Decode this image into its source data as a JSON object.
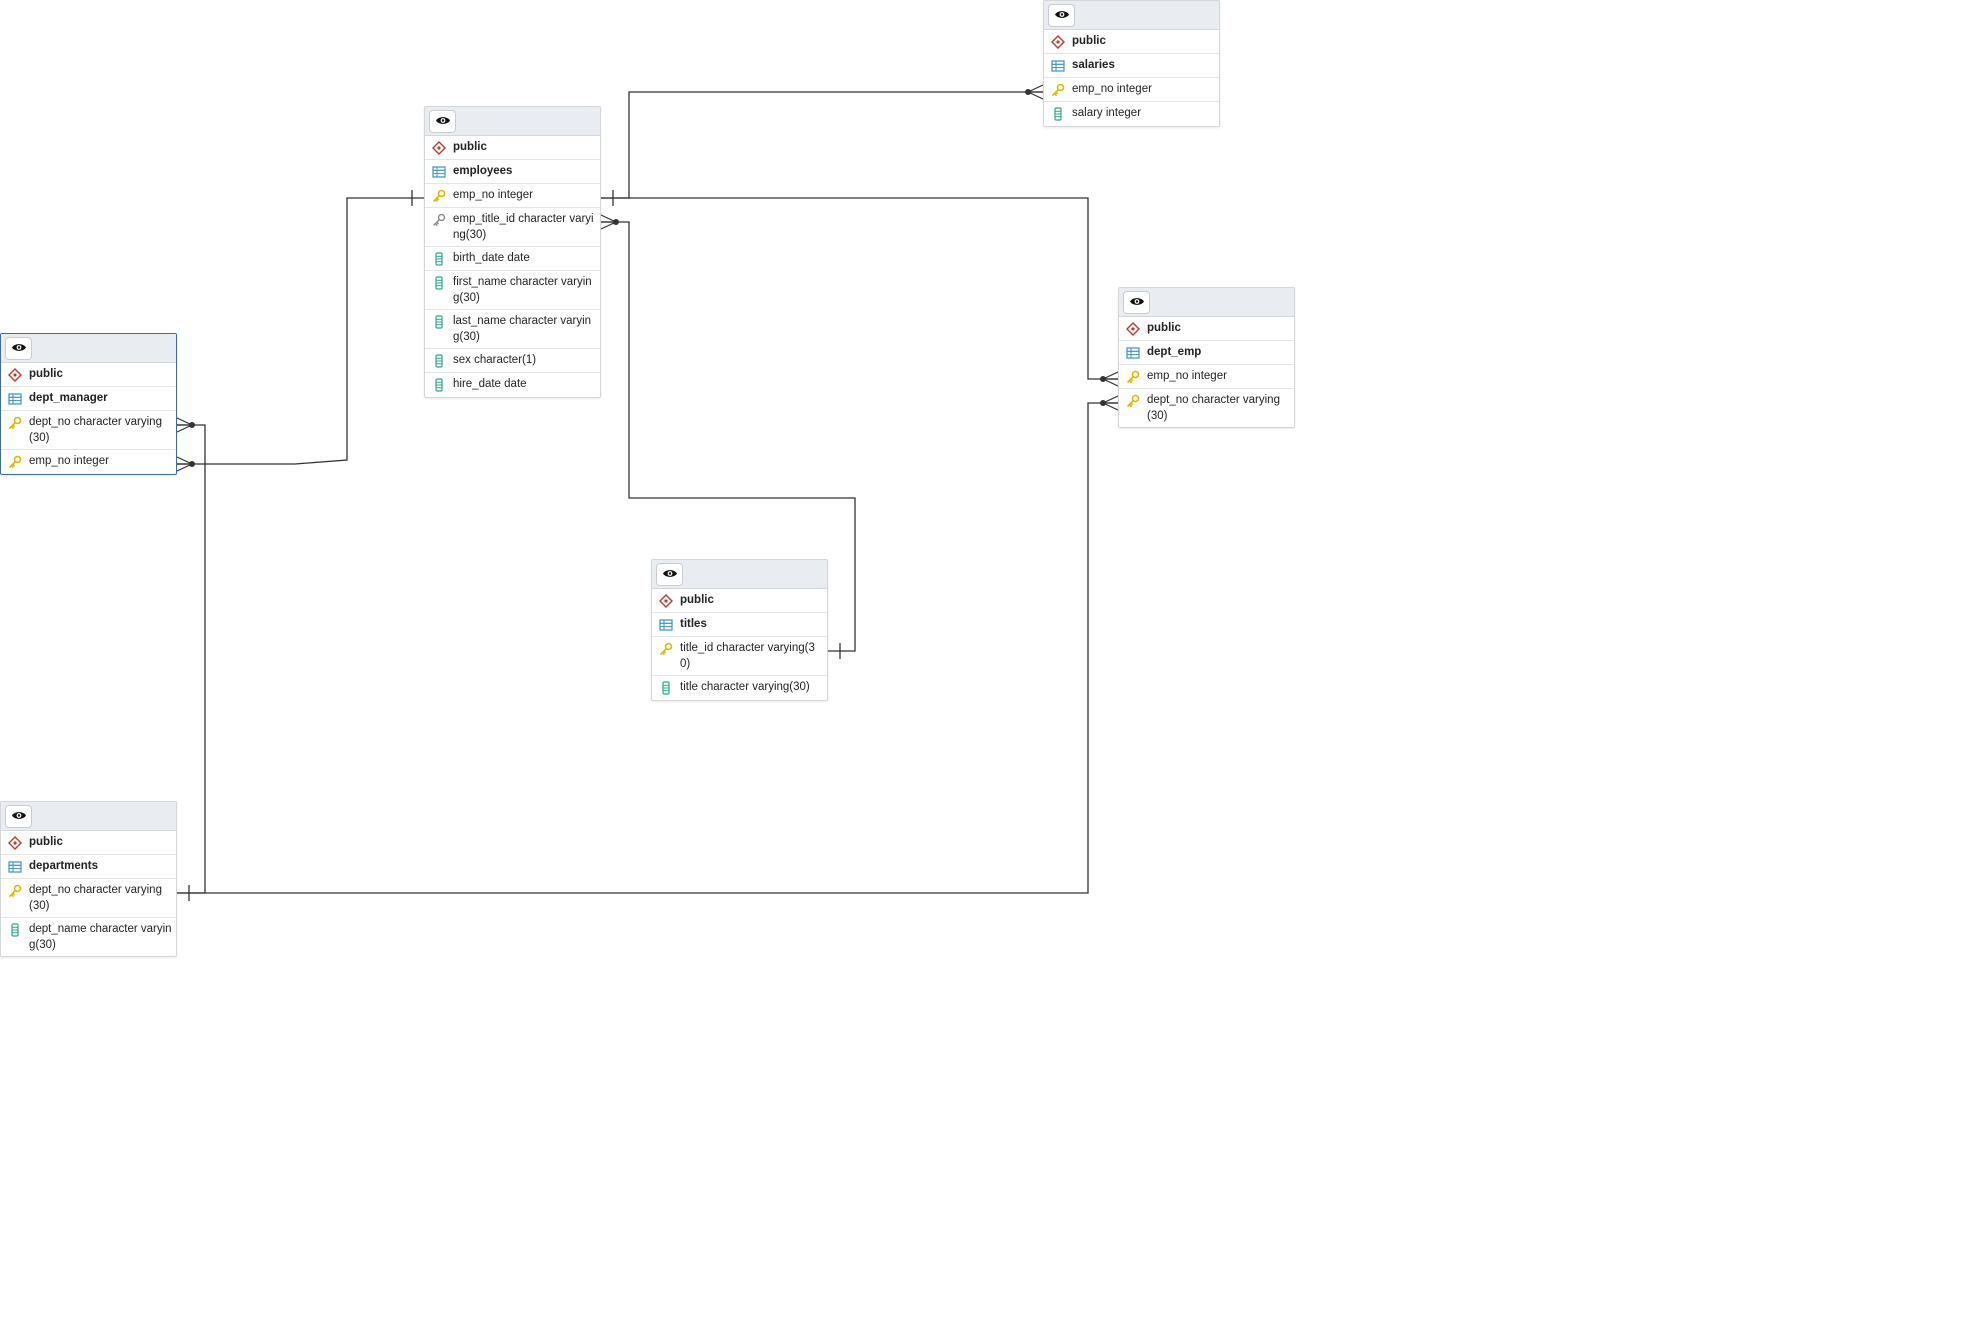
{
  "tables": [
    {
      "id": "salaries",
      "schema": "public",
      "name": "salaries",
      "columns": [
        {
          "text": "emp_no integer",
          "icon": "primary-key-icon"
        },
        {
          "text": "salary integer",
          "icon": "column-icon"
        }
      ]
    },
    {
      "id": "employees",
      "schema": "public",
      "name": "employees",
      "columns": [
        {
          "text": "emp_no integer",
          "icon": "primary-key-icon"
        },
        {
          "text": "emp_title_id character varying(30)",
          "icon": "foreign-key-icon"
        },
        {
          "text": "birth_date date",
          "icon": "column-icon"
        },
        {
          "text": "first_name character varying(30)",
          "icon": "column-icon"
        },
        {
          "text": "last_name character varying(30)",
          "icon": "column-icon"
        },
        {
          "text": "sex character(1)",
          "icon": "column-icon"
        },
        {
          "text": "hire_date date",
          "icon": "column-icon"
        }
      ]
    },
    {
      "id": "dept_emp",
      "schema": "public",
      "name": "dept_emp",
      "columns": [
        {
          "text": "emp_no integer",
          "icon": "primary-key-icon"
        },
        {
          "text": "dept_no character varying(30)",
          "icon": "primary-key-icon"
        }
      ]
    },
    {
      "id": "dept_manager",
      "schema": "public",
      "name": "dept_manager",
      "selected": true,
      "columns": [
        {
          "text": "dept_no character varying(30)",
          "icon": "primary-key-icon"
        },
        {
          "text": "emp_no integer",
          "icon": "primary-key-icon"
        }
      ]
    },
    {
      "id": "titles",
      "schema": "public",
      "name": "titles",
      "columns": [
        {
          "text": "title_id character varying(30)",
          "icon": "primary-key-icon"
        },
        {
          "text": "title character varying(30)",
          "icon": "column-icon"
        }
      ]
    },
    {
      "id": "departments",
      "schema": "public",
      "name": "departments",
      "columns": [
        {
          "text": "dept_no character varying(30)",
          "icon": "primary-key-icon"
        },
        {
          "text": "dept_name character varying(30)",
          "icon": "column-icon"
        }
      ]
    }
  ],
  "relationships": [
    {
      "from": "employees.emp_no",
      "to": "salaries.emp_no",
      "cardinality": "one-to-many"
    },
    {
      "from": "employees.emp_no",
      "to": "dept_emp.emp_no",
      "cardinality": "one-to-many"
    },
    {
      "from": "employees.emp_no",
      "to": "dept_manager.emp_no",
      "cardinality": "one-to-many"
    },
    {
      "from": "titles.title_id",
      "to": "employees.emp_title_id",
      "cardinality": "one-to-many"
    },
    {
      "from": "departments.dept_no",
      "to": "dept_manager.dept_no",
      "cardinality": "one-to-many"
    },
    {
      "from": "departments.dept_no",
      "to": "dept_emp.dept_no",
      "cardinality": "one-to-many"
    }
  ],
  "colors": {
    "header_bg": "#e9ecf1",
    "schema_icon": "#c0392b",
    "table_icon": "#3a8fd0",
    "primary_key_icon": "#e0b800",
    "foreign_key_icon": "#8a8a8a",
    "column_icon": "#2aa88c",
    "link": "#333333"
  }
}
